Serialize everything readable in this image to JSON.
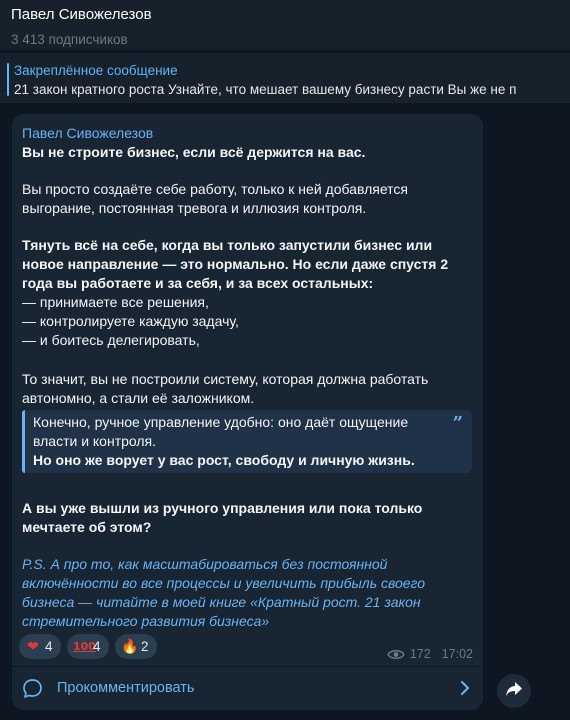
{
  "header": {
    "title": "Павел Сивожелезов",
    "subtitle": "3 413 подписчиков"
  },
  "pinned": {
    "title": "Закреплённое сообщение",
    "text": "21 закон кратного роста Узнайте, что мешает вашему бизнесу расти  Вы же не п"
  },
  "post": {
    "author": "Павел Сивожелезов",
    "line1": "Вы не строите бизнес, если всё держится на вас.",
    "p2_l1": "Вы просто создаёте себе работу, только к ней добавляется",
    "p2_l2": "выгорание, постоянная тревога и иллюзия контроля.",
    "p3_l1": "Тянуть всё на себе, когда вы только запустили бизнес или",
    "p3_l2": "новое направление — это нормально. Но если даже спустя 2",
    "p3_l3": "года вы работаете и за себя, и за всех остальных:",
    "li1": " — принимаете все решения,",
    "li2": " — контролируете каждую задачу,",
    "li3": " — и боитесь делегировать,",
    "p4_l1": "То значит, вы не построили систему, которая должна работать",
    "p4_l2": "автономно, а стали её заложником.",
    "quote_l1": "Конечно, ручное управление удобно: оно даёт ощущение",
    "quote_l2": "власти и контроля.",
    "quote_l3": "Но оно же ворует у вас рост, свободу и личную жизнь.",
    "quote_mark": "”",
    "q_l1": "А вы уже вышли из ручного управления или пока только",
    "q_l2": "мечтаете об этом?",
    "ps_l1": "P.S. А про то, как масштабироваться без постоянной",
    "ps_l2": "включённости во все процессы и увеличить прибыль своего",
    "ps_l3": "бизнеса — читайте в моей книге «Кратный рост. 21 закон",
    "ps_l4": "стремительного развития бизнеса»"
  },
  "reactions": [
    {
      "icon": "heart-icon",
      "glyph": "❤",
      "count": "4"
    },
    {
      "icon": "hundred-points-icon",
      "glyph": "100",
      "count": "4"
    },
    {
      "icon": "fire-icon",
      "glyph": "🔥",
      "count": "2"
    }
  ],
  "meta": {
    "views": "172",
    "time": "17:02"
  },
  "comment": {
    "label": "Прокомментировать"
  },
  "colors": {
    "background": "#0e1621",
    "bubble": "#182533",
    "accent": "#6ab3f3",
    "header": "#17212b"
  }
}
